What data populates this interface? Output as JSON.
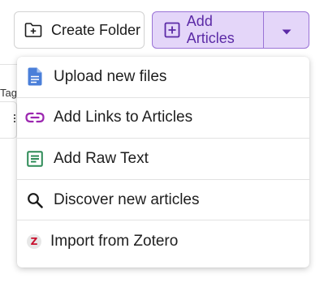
{
  "toolbar": {
    "create_folder_label": "Create Folder",
    "add_articles_label": "Add Articles"
  },
  "background": {
    "tags_fragment": "Tag"
  },
  "menu": {
    "items": [
      {
        "label": "Upload new files",
        "icon": "document-icon",
        "color": "#4a7fd9"
      },
      {
        "label": "Add Links to Articles",
        "icon": "link-icon",
        "color": "#9c27b0"
      },
      {
        "label": "Add Raw Text",
        "icon": "text-file-icon",
        "color": "#2e8b57"
      },
      {
        "label": "Discover new articles",
        "icon": "search-icon",
        "color": "#1a1a1a"
      },
      {
        "label": "Import from Zotero",
        "icon": "zotero-icon",
        "color": "#c8102e"
      }
    ]
  },
  "colors": {
    "accent_bg": "#e4d6f9",
    "accent_border": "#9a73d6",
    "accent_text": "#5b2aa6"
  }
}
